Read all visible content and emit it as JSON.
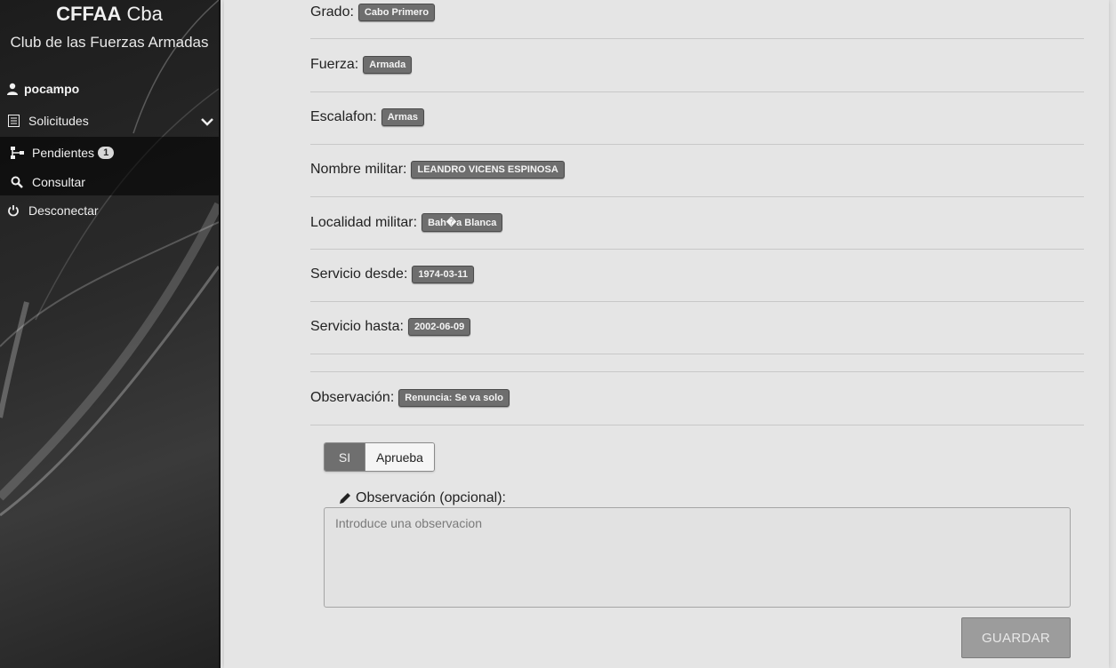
{
  "brand": {
    "title_bold": "CFFAA",
    "title_rest": "Cba",
    "subtitle": "Club de las Fuerzas Armadas"
  },
  "sidebar": {
    "user": "pocampo",
    "menu": {
      "label": "Solicitudes"
    },
    "submenu": [
      {
        "label": "Pendientes",
        "count": "1"
      },
      {
        "label": "Consultar"
      }
    ],
    "logout": "Desconectar"
  },
  "details": [
    {
      "label": "Grado:",
      "value": "Cabo Primero"
    },
    {
      "label": "Fuerza:",
      "value": "Armada"
    },
    {
      "label": "Escalafon:",
      "value": "Armas"
    },
    {
      "label": "Nombre militar:",
      "value": "LEANDRO VICENS ESPINOSA"
    },
    {
      "label": "Localidad militar:",
      "value": "Bah�a Blanca"
    },
    {
      "label": "Servicio desde:",
      "value": "1974-03-11"
    },
    {
      "label": "Servicio hasta:",
      "value": "2002-06-09"
    }
  ],
  "observation": {
    "label": "Observación:",
    "value": "Renuncia: Se va solo"
  },
  "approve_toggle": {
    "on_label": "SI",
    "off_label": "Aprueba"
  },
  "comment": {
    "label": "Observación (opcional):",
    "placeholder": "Introduce una observacion"
  },
  "save_label": "GUARDAR",
  "colors": {
    "badge_bg": "#6e6e6e",
    "button_bg": "#9c9c9c",
    "sidebar_bg": "#2b2b2b"
  }
}
